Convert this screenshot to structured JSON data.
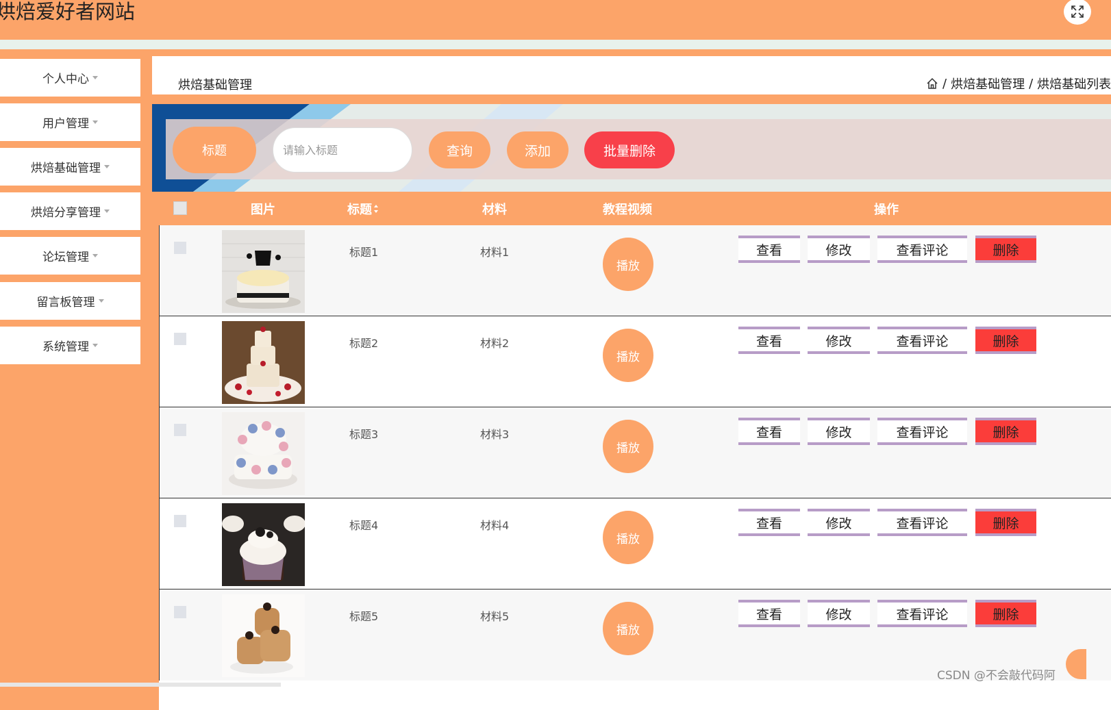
{
  "header": {
    "site_title": "烘焙爱好者网站",
    "fullscreen_icon": "fullscreen-icon"
  },
  "sidebar": {
    "items": [
      {
        "label": "个人中心"
      },
      {
        "label": "用户管理"
      },
      {
        "label": "烘焙基础管理"
      },
      {
        "label": "烘焙分享管理"
      },
      {
        "label": "论坛管理"
      },
      {
        "label": "留言板管理"
      },
      {
        "label": "系统管理"
      }
    ]
  },
  "breadcrumb": {
    "page_name": "烘焙基础管理",
    "home_icon": "home-icon",
    "sep1": "/",
    "level1": "烘焙基础管理",
    "sep2": "/",
    "level2": "烘焙基础列表"
  },
  "search": {
    "label": "标题",
    "placeholder": "请输入标题",
    "query_btn": "查询",
    "add_btn": "添加",
    "batch_delete_btn": "批量删除"
  },
  "table": {
    "headers": {
      "image": "图片",
      "title": "标题",
      "material": "材料",
      "video": "教程视频",
      "actions": "操作"
    },
    "rows": [
      {
        "title": "标题1",
        "material": "材料1",
        "play": "播放",
        "view": "查看",
        "edit": "修改",
        "comments": "查看评论",
        "delete": "删除"
      },
      {
        "title": "标题2",
        "material": "材料2",
        "play": "播放",
        "view": "查看",
        "edit": "修改",
        "comments": "查看评论",
        "delete": "删除"
      },
      {
        "title": "标题3",
        "material": "材料3",
        "play": "播放",
        "view": "查看",
        "edit": "修改",
        "comments": "查看评论",
        "delete": "删除"
      },
      {
        "title": "标题4",
        "material": "材料4",
        "play": "播放",
        "view": "查看",
        "edit": "修改",
        "comments": "查看评论",
        "delete": "删除"
      },
      {
        "title": "标题5",
        "material": "材料5",
        "play": "播放",
        "view": "查看",
        "edit": "修改",
        "comments": "查看评论",
        "delete": "删除"
      }
    ]
  },
  "watermark": "CSDN @不会敲代码阿",
  "colors": {
    "primary": "#fca469",
    "danger": "#f8404a",
    "op_border": "#b79cc7"
  }
}
